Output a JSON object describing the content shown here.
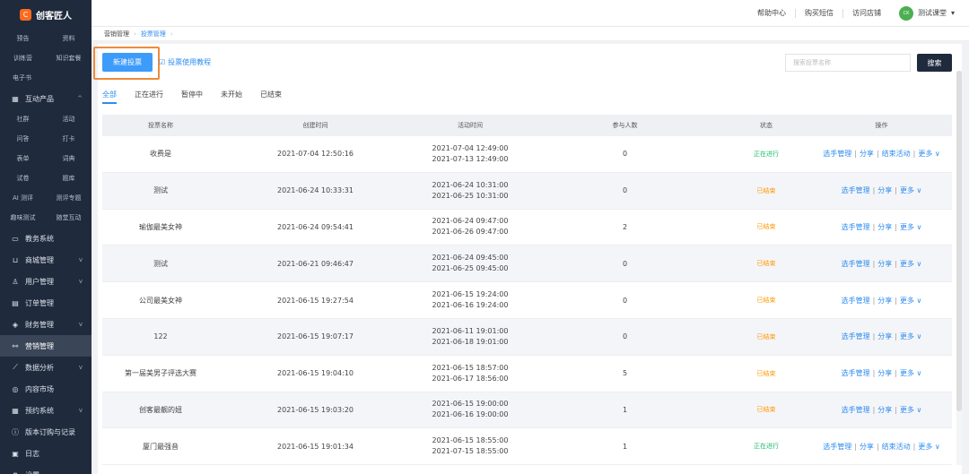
{
  "brand": {
    "name": "创客匠人",
    "logo_mark": "C"
  },
  "sidebar": {
    "grid_rows": [
      [
        "预告",
        "资料"
      ],
      [
        "训练营",
        "知识套餐"
      ]
    ],
    "single_row_1": "电子书",
    "interactive_menu": {
      "label": "互动产品",
      "icon": "grid-icon",
      "arrow": "^"
    },
    "interactive_grid": [
      [
        "社群",
        "活动"
      ],
      [
        "问答",
        "打卡"
      ],
      [
        "表单",
        "词典"
      ],
      [
        "试卷",
        "题库"
      ],
      [
        "AI 测评",
        "测评专题"
      ],
      [
        "趣味测试",
        "随堂互动"
      ]
    ],
    "menu": [
      {
        "label": "教务系统",
        "icon": "monitor-icon",
        "arrow": ""
      },
      {
        "label": "商城管理",
        "icon": "cart-icon",
        "arrow": "v"
      },
      {
        "label": "用户管理",
        "icon": "user-icon",
        "arrow": "v"
      },
      {
        "label": "订单管理",
        "icon": "doc-icon",
        "arrow": ""
      },
      {
        "label": "财务管理",
        "icon": "shield-icon",
        "arrow": "v"
      },
      {
        "label": "营销管理",
        "icon": "share-icon",
        "arrow": "",
        "active": true
      },
      {
        "label": "数据分析",
        "icon": "chart-icon",
        "arrow": "v"
      },
      {
        "label": "内容市场",
        "icon": "store-icon",
        "arrow": ""
      },
      {
        "label": "预约系统",
        "icon": "calendar-icon",
        "arrow": "v"
      },
      {
        "label": "版本订购与记录",
        "icon": "info-icon",
        "arrow": ""
      },
      {
        "label": "日志",
        "icon": "log-icon",
        "arrow": ""
      },
      {
        "label": "设置",
        "icon": "gear-icon",
        "arrow": ""
      }
    ]
  },
  "topbar": {
    "links": [
      "帮助中心",
      "购买短信",
      "访问店铺"
    ],
    "user_name": "测试课堂",
    "avatar_text": "CK",
    "dropdown": "▾"
  },
  "breadcrumb": {
    "items": [
      "营销管理",
      "投票管理"
    ],
    "sep": "›"
  },
  "toolbar": {
    "new_button": "新建投票",
    "help_link": "投票使用教程",
    "search_placeholder": "搜索投票名称",
    "search_button": "搜索"
  },
  "tabs": [
    "全部",
    "正在进行",
    "暂停中",
    "未开始",
    "已结束"
  ],
  "table": {
    "headers": [
      "投票名称",
      "创建时间",
      "活动时间",
      "参与人数",
      "状态",
      "操作"
    ],
    "rows": [
      {
        "name": "收费是",
        "created": "2021-07-04 12:50:16",
        "start": "2021-07-04 12:49:00",
        "end": "2021-07-13 12:49:00",
        "count": "0",
        "status": "正在进行",
        "status_color": "#19be6b",
        "ops": [
          "选手管理",
          "分享",
          "结束活动",
          "更多 ∨"
        ]
      },
      {
        "name": "测试",
        "created": "2021-06-24 10:33:31",
        "start": "2021-06-24 10:31:00",
        "end": "2021-06-25 10:31:00",
        "count": "0",
        "status": "已结束",
        "status_color": "#ff9900",
        "ops": [
          "选手管理",
          "分享",
          "更多 ∨"
        ]
      },
      {
        "name": "瑜伽最美女神",
        "created": "2021-06-24 09:54:41",
        "start": "2021-06-24 09:47:00",
        "end": "2021-06-26 09:47:00",
        "count": "2",
        "status": "已结束",
        "status_color": "#ff9900",
        "ops": [
          "选手管理",
          "分享",
          "更多 ∨"
        ]
      },
      {
        "name": "测试",
        "created": "2021-06-21 09:46:47",
        "start": "2021-06-24 09:45:00",
        "end": "2021-06-25 09:45:00",
        "count": "0",
        "status": "已结束",
        "status_color": "#ff9900",
        "ops": [
          "选手管理",
          "分享",
          "更多 ∨"
        ]
      },
      {
        "name": "公司最美女神",
        "created": "2021-06-15 19:27:54",
        "start": "2021-06-15 19:24:00",
        "end": "2021-06-16 19:24:00",
        "count": "0",
        "status": "已结束",
        "status_color": "#ff9900",
        "ops": [
          "选手管理",
          "分享",
          "更多 ∨"
        ]
      },
      {
        "name": "122",
        "created": "2021-06-15 19:07:17",
        "start": "2021-06-11 19:01:00",
        "end": "2021-06-18 19:01:00",
        "count": "0",
        "status": "已结束",
        "status_color": "#ff9900",
        "ops": [
          "选手管理",
          "分享",
          "更多 ∨"
        ]
      },
      {
        "name": "第一届美男子评选大赛",
        "created": "2021-06-15 19:04:10",
        "start": "2021-06-15 18:57:00",
        "end": "2021-06-17 18:56:00",
        "count": "5",
        "status": "已结束",
        "status_color": "#ff9900",
        "ops": [
          "选手管理",
          "分享",
          "更多 ∨"
        ]
      },
      {
        "name": "创客最靓的妞",
        "created": "2021-06-15 19:03:20",
        "start": "2021-06-15 19:00:00",
        "end": "2021-06-16 19:00:00",
        "count": "1",
        "status": "已结束",
        "status_color": "#ff9900",
        "ops": [
          "选手管理",
          "分享",
          "更多 ∨"
        ]
      },
      {
        "name": "厦门最强音",
        "created": "2021-06-15 19:01:34",
        "start": "2021-06-15 18:55:00",
        "end": "2021-07-15 18:55:00",
        "count": "1",
        "status": "正在进行",
        "status_color": "#19be6b",
        "ops": [
          "选手管理",
          "分享",
          "结束活动",
          "更多 ∨"
        ]
      }
    ]
  }
}
